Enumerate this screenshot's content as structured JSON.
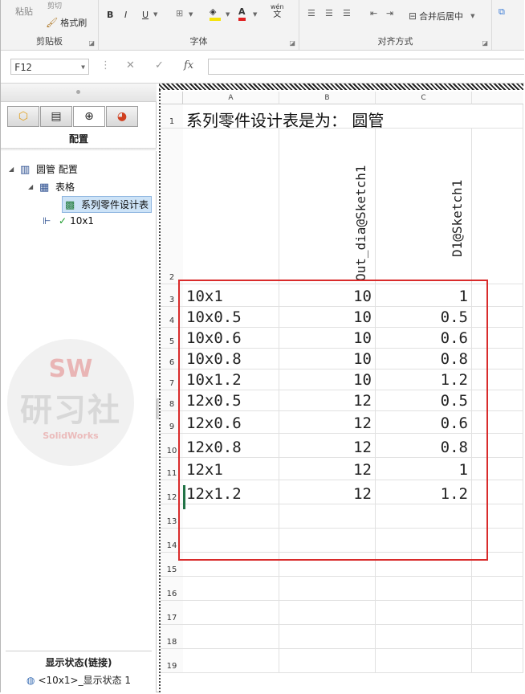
{
  "ribbon": {
    "clipboard": {
      "paste": "粘贴",
      "cut": "剪切",
      "format_painter": "格式刷",
      "label": "剪贴板"
    },
    "font": {
      "bold": "B",
      "italic": "I",
      "underline": "U",
      "phonetic_top": "wén",
      "phonetic_bottom": "文",
      "label": "字体"
    },
    "alignment": {
      "merge_center": "合并后居中",
      "label": "对齐方式"
    }
  },
  "formula_bar": {
    "name_box": "F12",
    "cancel": "✕",
    "enter": "✓",
    "fx": "fx",
    "value": ""
  },
  "feature_manager": {
    "title": "配置",
    "tree": [
      {
        "label": "圆管 配置"
      },
      {
        "label": "表格"
      },
      {
        "label": "系列零件设计表"
      },
      {
        "label": "10x1"
      }
    ],
    "watermark": {
      "top": "SW",
      "main": "研习社",
      "sub": "SolidWorks"
    },
    "display_state_title": "显示状态(链接)",
    "display_state_item": "<10x1>_显示状态 1"
  },
  "sheet": {
    "columns": [
      "A",
      "B",
      "C"
    ],
    "title": "系列零件设计表是为：   圆管",
    "headers": {
      "b": "Out_dia@Sketch1",
      "c": "D1@Sketch1"
    },
    "row_numbers": [
      "1",
      "2",
      "3",
      "4",
      "5",
      "6",
      "7",
      "8",
      "9",
      "10",
      "11",
      "12",
      "13",
      "14",
      "15",
      "16",
      "17",
      "18",
      "19"
    ],
    "rows": [
      {
        "name": "10x1",
        "b": "10",
        "c": "1"
      },
      {
        "name": "10x0.5",
        "b": "10",
        "c": "0.5"
      },
      {
        "name": "10x0.6",
        "b": "10",
        "c": "0.6"
      },
      {
        "name": "10x0.8",
        "b": "10",
        "c": "0.8"
      },
      {
        "name": "10x1.2",
        "b": "10",
        "c": "1.2"
      },
      {
        "name": "12x0.5",
        "b": "12",
        "c": "0.5"
      },
      {
        "name": "12x0.6",
        "b": "12",
        "c": "0.6"
      },
      {
        "name": "12x0.8",
        "b": "12",
        "c": "0.8"
      },
      {
        "name": "12x1",
        "b": "12",
        "c": "1"
      },
      {
        "name": "12x1.2",
        "b": "12",
        "c": "1.2"
      }
    ]
  },
  "colors": {
    "highlight_box": "#d92b2b",
    "excel_green": "#217346",
    "selection": "#cde3f7"
  }
}
